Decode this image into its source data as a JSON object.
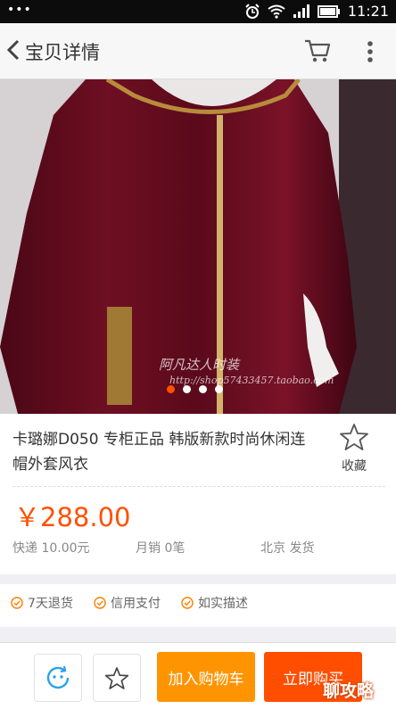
{
  "status_bar": {
    "dots": "•••",
    "time": "11:21"
  },
  "nav": {
    "title": "宝贝详情"
  },
  "gallery": {
    "watermark_line1": "阿凡达人时装",
    "watermark_line2": "http://shop57433457.taobao.com",
    "page_count": 4,
    "active_index": 0
  },
  "product": {
    "title": "卡璐娜D050 专柜正品 韩版新款时尚休闲连帽外套风衣",
    "favorite_label": "收藏",
    "price": "￥288.00",
    "shipping": "快递 10.00元",
    "monthly_sales": "月销 0笔",
    "ship_from": "北京 发货"
  },
  "services": [
    "7天退货",
    "信用支付",
    "如实描述"
  ],
  "actions": {
    "add_to_cart": "加入购物车",
    "buy_now": "立即购买"
  },
  "overlay": {
    "corner_text": "聊攻略"
  },
  "colors": {
    "accent": "#ff5000",
    "cart_button": "#ff9402",
    "buy_button": "#ff4e00"
  }
}
